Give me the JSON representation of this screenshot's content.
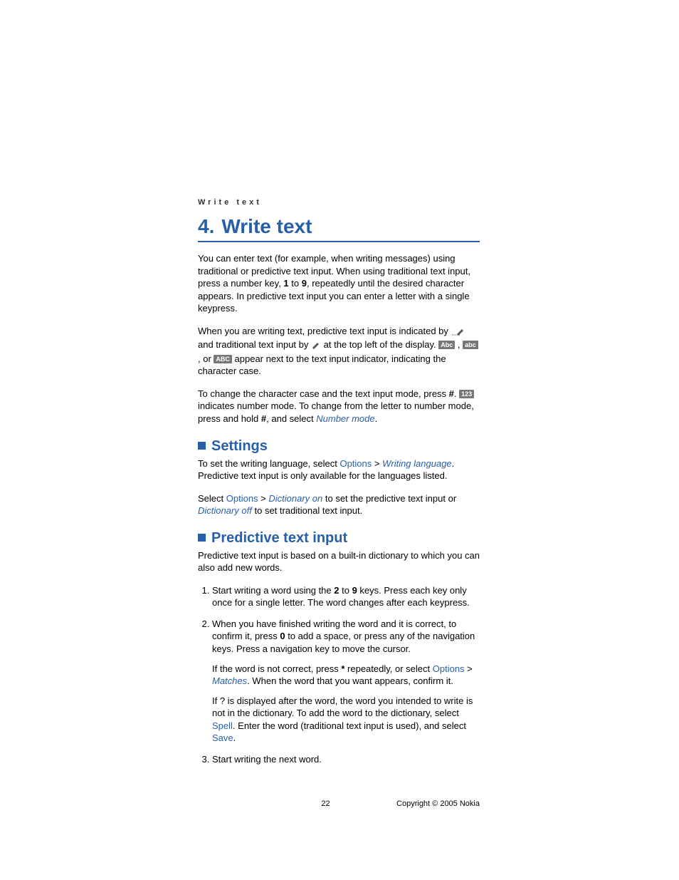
{
  "header": {
    "label": "Write text"
  },
  "chapter": {
    "number": "4.",
    "title": "Write text"
  },
  "intro": {
    "p1_a": "You can enter text (for example, when writing messages) using traditional or predictive text input. When using traditional text input, press a number key, ",
    "k1": "1",
    "p1_b": " to ",
    "k9": "9",
    "p1_c": ", repeatedly until the desired character appears. In predictive text input you can enter a letter with a single keypress."
  },
  "para2": {
    "a": "When you are writing text, predictive text input is indicated by ",
    "b": " and traditional text input by ",
    "c": " at the top left of the display. ",
    "iconAbc": "Abc",
    "d": " , ",
    "iconabc": "abc",
    "e": " , or ",
    "iconABC": "ABC",
    "f": " appear next to the text input indicator, indicating the character case."
  },
  "para3": {
    "a": "To change the character case and the text input mode, press ",
    "hash": "#",
    "b": ". ",
    "icon123": "123",
    "c": " indicates number mode. To change from the letter to number mode, press and hold ",
    "d": ", and select ",
    "nm": "Number mode",
    "e": "."
  },
  "settings": {
    "heading": "Settings",
    "p1_a": "To set the writing language, select ",
    "opt": "Options",
    "gt": " > ",
    "wl": "Writing language",
    "p1_b": ". Predictive text input is only available for the languages listed.",
    "p2_a": "Select ",
    "don": "Dictionary on",
    "p2_b": " to set the predictive text input or ",
    "doff": "Dictionary off",
    "p2_c": " to set traditional text input."
  },
  "predictive": {
    "heading": "Predictive text input",
    "intro": "Predictive text input is based on a built-in dictionary to which you can also add new words.",
    "li1_a": "Start writing a word using the ",
    "k2": "2",
    "li1_b": " to ",
    "k9": "9",
    "li1_c": " keys. Press each key only once for a single letter. The word changes after each keypress.",
    "li2_a": "When you have finished writing the word and it is correct, to confirm it, press ",
    "k0": "0",
    "li2_b": " to add a space, or press any of the navigation keys. Press a navigation key to move the cursor.",
    "li2_p2_a": "If the word is not correct, press ",
    "star": "*",
    "li2_p2_b": " repeatedly, or select ",
    "opt": "Options",
    "gt": " > ",
    "matches": "Matches",
    "li2_p2_c": ". When the word that you want appears, confirm it.",
    "li2_p3_a": "If ? is displayed after the word, the word you intended to write is not in the dictionary. To add the word to the dictionary, select ",
    "spell": "Spell",
    "li2_p3_b": ". Enter the word (traditional text input is used), and select ",
    "save": "Save",
    "li2_p3_c": ".",
    "li3": "Start writing the next word."
  },
  "footer": {
    "page": "22",
    "copyright": "Copyright © 2005 Nokia"
  }
}
